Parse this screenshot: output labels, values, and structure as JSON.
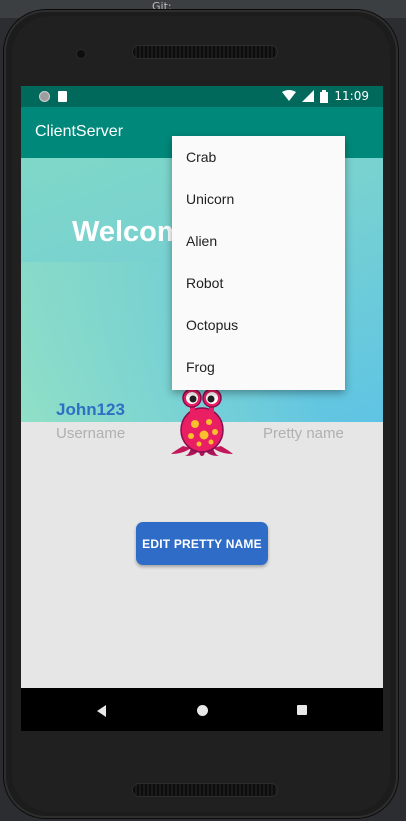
{
  "ide": {
    "tab_text": "Git:"
  },
  "status_bar": {
    "time": "11:09"
  },
  "app_bar": {
    "title": "ClientServer"
  },
  "banner": {
    "welcome_text": "Welcom"
  },
  "profile": {
    "username_value": "John123",
    "username_label": "Username",
    "pretty_name_label": "Pretty name"
  },
  "buttons": {
    "edit_pretty_name": "EDIT PRETTY NAME"
  },
  "avatar_menu": {
    "items": [
      "Crab",
      "Unicorn",
      "Alien",
      "Robot",
      "Octopus",
      "Frog"
    ]
  },
  "colors": {
    "status_bar": "#00695c",
    "app_bar": "#00897b",
    "accent_blue": "#2f6cc8",
    "username_blue": "#2e6fc4"
  }
}
